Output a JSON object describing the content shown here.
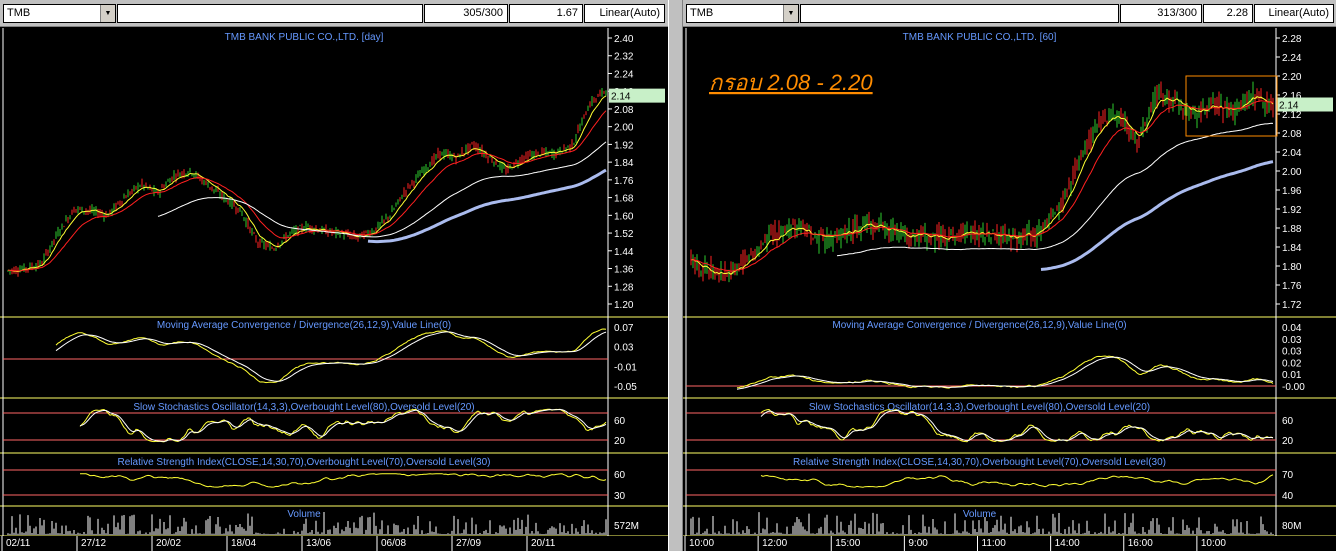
{
  "left": {
    "symbol": "TMB",
    "count": "305/300",
    "zoom": "1.67",
    "scale_mode": "Linear(Auto)",
    "title": "TMB BANK PUBLIC CO.,LTD. [day]",
    "price_label": "2.14",
    "price_ticks": [
      "2.40",
      "2.32",
      "2.24",
      "2.16",
      "2.08",
      "2.00",
      "1.92",
      "1.84",
      "1.76",
      "1.68",
      "1.60",
      "1.52",
      "1.44",
      "1.36",
      "1.28",
      "1.20"
    ],
    "macd_title": "Moving Average Convergence / Divergence(26,12,9),Value Line(0)",
    "macd_ticks": [
      "0.07",
      "0.03",
      "-0.01",
      "-0.05"
    ],
    "stoch_title": "Slow Stochastics Oscillator(14,3,3),Overbought Level(80),Oversold Level(20)",
    "stoch_ticks": [
      "60",
      "20"
    ],
    "rsi_title": "Relative Strength Index(CLOSE,14,30,70),Overbought Level(70),Oversold Level(30)",
    "rsi_ticks": [
      "60",
      "30"
    ],
    "volume_title": "Volume",
    "volume_tick": "572M",
    "x_ticks": [
      "02/11",
      "27/12",
      "20/02",
      "18/04",
      "13/06",
      "06/08",
      "27/09",
      "20/11"
    ]
  },
  "right": {
    "symbol": "TMB",
    "count": "313/300",
    "zoom": "2.28",
    "scale_mode": "Linear(Auto)",
    "title": "TMB BANK PUBLIC CO.,LTD. [60]",
    "annotation": "กรอบ 2.08 - 2.20",
    "price_label": "2.14",
    "price_ticks": [
      "2.28",
      "2.24",
      "2.20",
      "2.16",
      "2.12",
      "2.08",
      "2.04",
      "2.00",
      "1.96",
      "1.92",
      "1.88",
      "1.84",
      "1.80",
      "1.76",
      "1.72"
    ],
    "macd_title": "Moving Average Convergence / Divergence(26,12,9),Value Line(0)",
    "macd_ticks": [
      "0.04",
      "0.03",
      "0.03",
      "0.02",
      "0.01",
      "-0.00"
    ],
    "stoch_title": "Slow Stochastics Oscillator(14,3,3),Overbought Level(80),Oversold Level(20)",
    "stoch_ticks": [
      "60",
      "20"
    ],
    "rsi_title": "Relative Strength Index(CLOSE,14,30,70),Overbought Level(70),Oversold Level(30)",
    "rsi_ticks": [
      "70",
      "40"
    ],
    "volume_title": "Volume",
    "volume_tick": "80M",
    "x_ticks": [
      "10:00",
      "12:00",
      "15:00",
      "9:00",
      "11:00",
      "14:00",
      "16:00",
      "10:00"
    ]
  },
  "colors": {
    "bull": "#2ecc2e",
    "bear": "#ff2222",
    "ma_fast": "#ffff33",
    "ma_mid": "#ff2020",
    "ma_slow": "#ffffff",
    "ma_long": "#aabbee",
    "grid": "#ffff66",
    "title_text": "#6699ff",
    "annotation": "#ff8c00"
  }
}
